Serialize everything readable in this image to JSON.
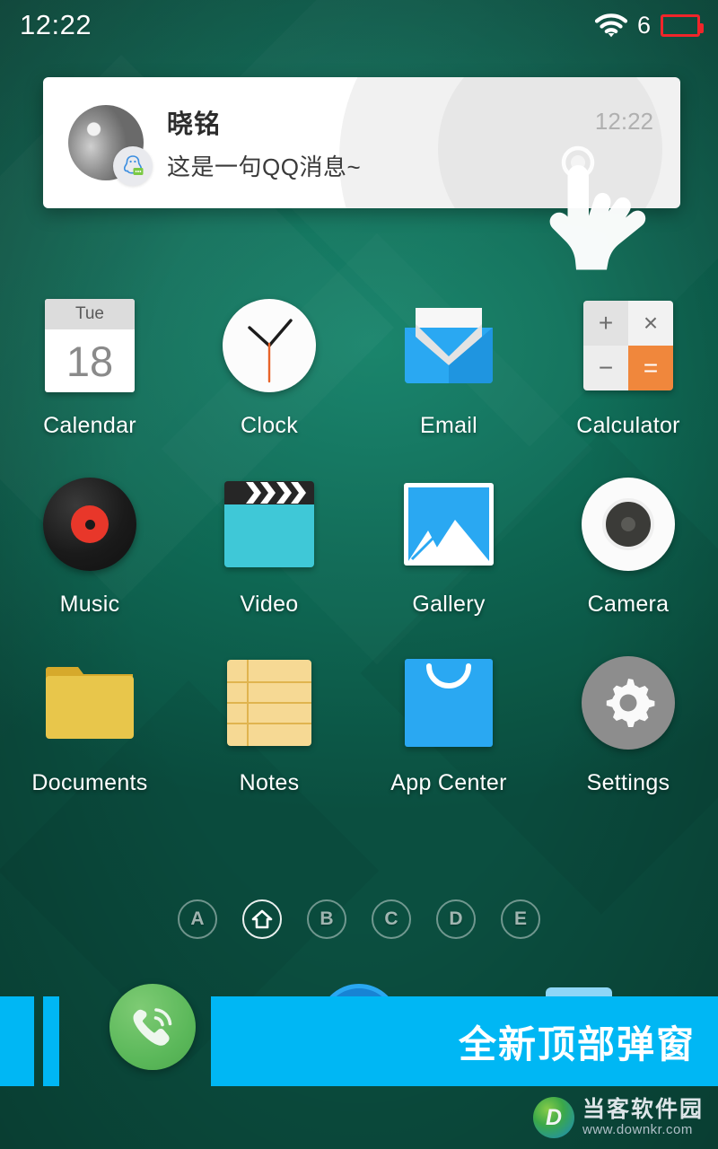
{
  "statusbar": {
    "time": "12:22",
    "wifi_icon": "wifi-icon",
    "signal_number": "6",
    "battery_icon": "battery-empty-icon"
  },
  "notification": {
    "sender": "晓铭",
    "message": "这是一句QQ消息~",
    "time": "12:22",
    "avatar_icon": "avatar-photo",
    "app_badge_icon": "qq-penguin-icon",
    "cursor_icon": "hand-tap-icon"
  },
  "apps": [
    {
      "label": "Calendar",
      "icon": "calendar-icon",
      "weekday": "Tue",
      "day": "18"
    },
    {
      "label": "Clock",
      "icon": "clock-icon"
    },
    {
      "label": "Email",
      "icon": "email-envelope-icon"
    },
    {
      "label": "Calculator",
      "icon": "calculator-icon",
      "keys": [
        "+",
        "×",
        "−",
        "="
      ]
    },
    {
      "label": "Music",
      "icon": "vinyl-record-icon"
    },
    {
      "label": "Video",
      "icon": "clapperboard-icon"
    },
    {
      "label": "Gallery",
      "icon": "photo-mountain-icon"
    },
    {
      "label": "Camera",
      "icon": "camera-lens-icon"
    },
    {
      "label": "Documents",
      "icon": "folder-icon"
    },
    {
      "label": "Notes",
      "icon": "notepad-icon"
    },
    {
      "label": "App Center",
      "icon": "shopping-bag-icon"
    },
    {
      "label": "Settings",
      "icon": "gear-icon"
    }
  ],
  "page_indicator": [
    {
      "label": "A",
      "active": false
    },
    {
      "label": "",
      "active": true,
      "icon": "home-icon"
    },
    {
      "label": "B",
      "active": false
    },
    {
      "label": "C",
      "active": false
    },
    {
      "label": "D",
      "active": false
    },
    {
      "label": "E",
      "active": false
    }
  ],
  "dock": {
    "phone_icon": "phone-dialer-icon",
    "blue_circle_icon": "dock-app-icon",
    "lightblue_icon": "dock-app-icon"
  },
  "promo": {
    "text": "全新顶部弹窗",
    "color": "#00b7f4"
  },
  "watermark": {
    "logo_letter": "D",
    "name": "当客软件园",
    "url": "www.downkr.com"
  },
  "colors": {
    "wallpaper_green": "#0f6b56",
    "accent_blue": "#2aa8f2",
    "calc_orange": "#f0873c",
    "battery_red": "#f0252a",
    "promo_blue": "#00b7f4"
  }
}
